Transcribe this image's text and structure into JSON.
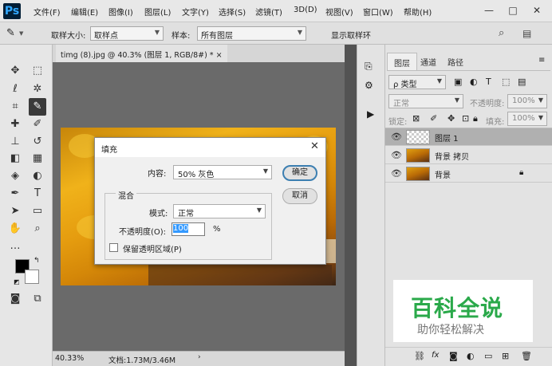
{
  "app": {
    "logo": "Ps"
  },
  "menu": [
    "文件(F)",
    "编辑(E)",
    "图像(I)",
    "图层(L)",
    "文字(Y)",
    "选择(S)",
    "滤镜(T)",
    "3D(D)",
    "视图(V)",
    "窗口(W)",
    "帮助(H)"
  ],
  "window_controls": {
    "minimize": "—",
    "maximize": "□",
    "close": "✕"
  },
  "options_bar": {
    "sample_size_label": "取样大小:",
    "sample_size_value": "取样点",
    "sample_label": "样本:",
    "sample_value": "所有图层",
    "show_ring_label": "显示取样环",
    "show_ring_checked": true
  },
  "document": {
    "tab_title": "timg (8).jpg @ 40.3% (图层 1, RGB/8#) *",
    "tab_close": "×",
    "zoom": "40.33%",
    "doc_info": "文档:1.73M/3.46M"
  },
  "layers_panel": {
    "tabs": [
      "图层",
      "通道",
      "路径"
    ],
    "kind_label": "ρ 类型",
    "blend_mode": "正常",
    "opacity_label": "不透明度:",
    "opacity_value": "100%",
    "lock_label": "锁定:",
    "fill_label": "填充:",
    "fill_value": "100%",
    "layers": [
      {
        "name": "图层 1",
        "selected": true,
        "transparent": true,
        "locked": false
      },
      {
        "name": "背景 拷贝",
        "selected": false,
        "transparent": false,
        "locked": false
      },
      {
        "name": "背景",
        "selected": false,
        "transparent": false,
        "locked": true
      }
    ],
    "bottom_icons": [
      "link-icon",
      "fx-icon",
      "mask-icon",
      "adjustment-icon",
      "group-icon",
      "new-layer-icon",
      "trash-icon"
    ]
  },
  "fill_dialog": {
    "title": "填充",
    "content_label": "内容:",
    "content_value": "50% 灰色",
    "blending_group": "混合",
    "mode_label": "模式:",
    "mode_value": "正常",
    "opacity_label": "不透明度(O):",
    "opacity_value": "100",
    "opacity_unit": "%",
    "preserve_label": "保留透明区域(P)",
    "preserve_checked": false,
    "ok_label": "确定",
    "cancel_label": "取消"
  },
  "watermark": {
    "title": "百科全说",
    "subtitle": "助你轻松解决"
  },
  "colors": {
    "accent": "#31a8ff",
    "watermark_green": "#2aa94a"
  }
}
